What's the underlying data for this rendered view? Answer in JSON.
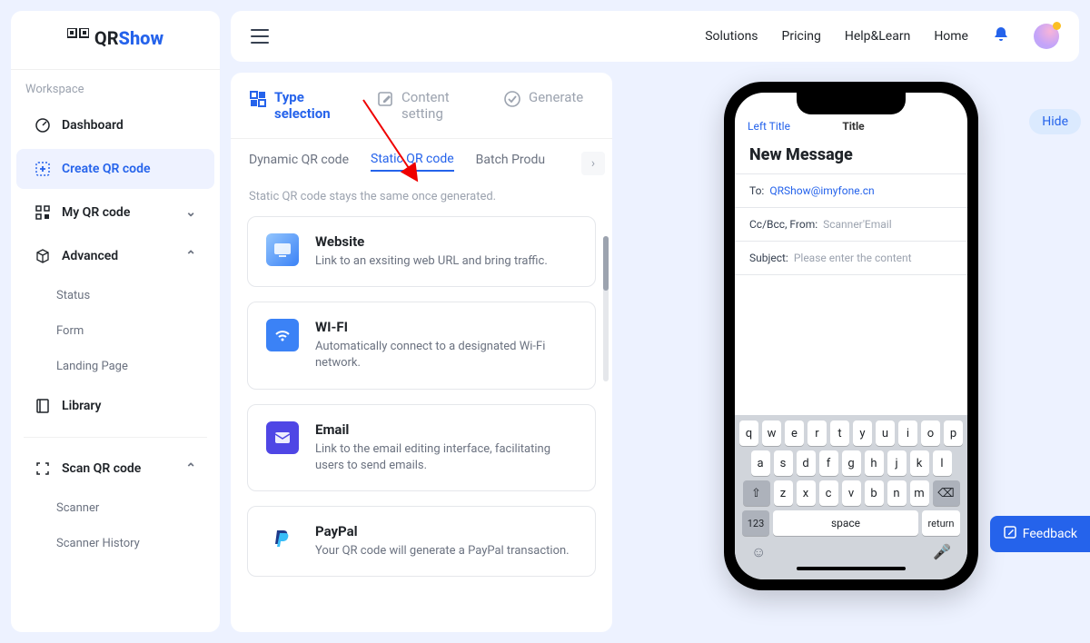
{
  "logo": {
    "brand": "QR",
    "suffix": "Show"
  },
  "sidebar": {
    "workspace_label": "Workspace",
    "items": [
      {
        "label": "Dashboard",
        "icon": "dashboard"
      },
      {
        "label": "Create QR code",
        "icon": "plus",
        "active": true
      },
      {
        "label": "My QR code",
        "icon": "grid",
        "expandable": true
      },
      {
        "label": "Advanced",
        "icon": "cube",
        "expandable": true,
        "open": true
      },
      {
        "label": "Library",
        "icon": "book"
      },
      {
        "label": "Scan QR code",
        "icon": "scan",
        "expandable": true,
        "open": true
      }
    ],
    "advanced_sub": [
      "Status",
      "Form",
      "Landing Page"
    ],
    "scan_sub": [
      "Scanner",
      "Scanner History"
    ]
  },
  "topbar": {
    "links": [
      "Solutions",
      "Pricing",
      "Help&Learn",
      "Home"
    ]
  },
  "steps": [
    {
      "label": "Type selection",
      "active": true
    },
    {
      "label": "Content setting",
      "active": false
    },
    {
      "label": "Generate",
      "active": false
    }
  ],
  "tabs": [
    "Dynamic QR code",
    "Static QR code",
    "Batch Produ"
  ],
  "active_tab": "Static QR code",
  "static_note": "Static QR code stays the same once generated.",
  "types": [
    {
      "title": "Website",
      "desc": "Link to an exsiting web URL and bring traffic.",
      "icon": "web"
    },
    {
      "title": "WI-FI",
      "desc": "Automatically connect to a designated Wi-Fi network.",
      "icon": "wifi"
    },
    {
      "title": "Email",
      "desc": "Link to the email editing interface, facilitating users to send emails.",
      "icon": "email"
    },
    {
      "title": "PayPal",
      "desc": "Your QR code will generate a PayPal transaction.",
      "icon": "paypal"
    }
  ],
  "phone": {
    "left_title": "Left Title",
    "center_title": "Title",
    "heading": "New Message",
    "to_label": "To:",
    "to_value": "QRShow@imyfone.cn",
    "cc_label": "Cc/Bcc, From:",
    "cc_placeholder": "Scanner'Email",
    "subject_label": "Subject:",
    "subject_placeholder": "Please enter the content",
    "keyboard_rows": [
      [
        "q",
        "w",
        "e",
        "r",
        "t",
        "y",
        "u",
        "i",
        "o",
        "p"
      ],
      [
        "a",
        "s",
        "d",
        "f",
        "g",
        "h",
        "j",
        "k",
        "l"
      ],
      [
        "z",
        "x",
        "c",
        "v",
        "b",
        "n",
        "m"
      ]
    ],
    "num_key": "123",
    "space_key": "space",
    "return_key": "return"
  },
  "hide_label": "Hide",
  "feedback_label": "Feedback"
}
